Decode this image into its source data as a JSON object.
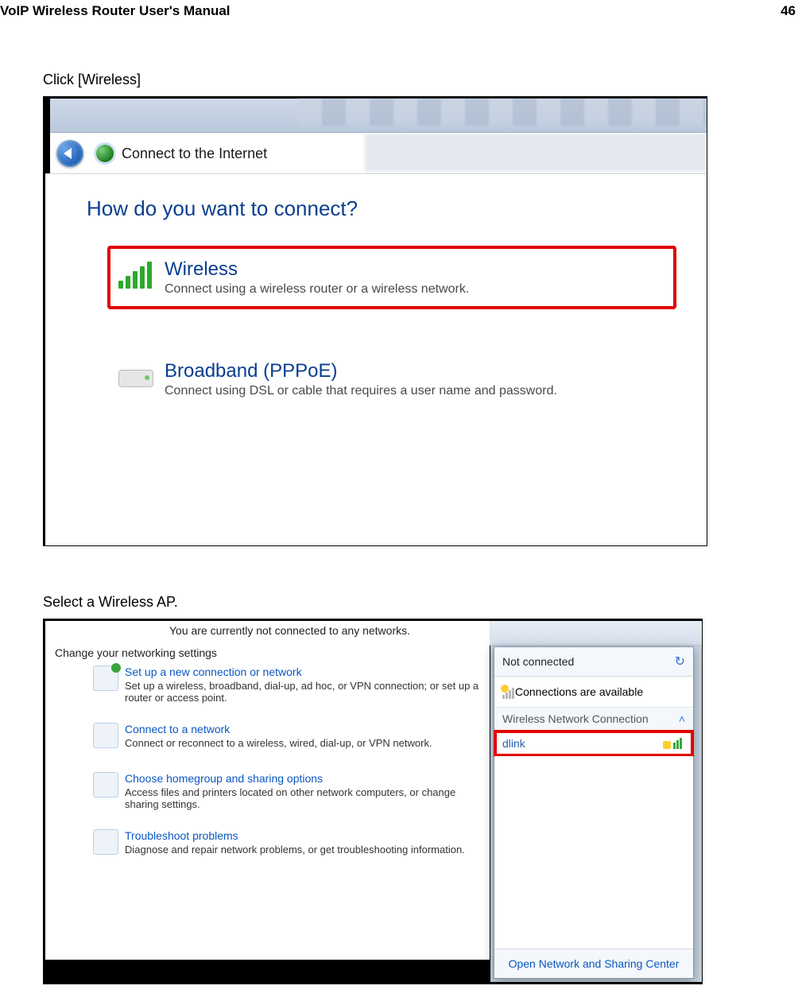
{
  "header": {
    "title": "VoIP Wireless Router User's Manual",
    "page_number": "46"
  },
  "step1": {
    "instruction": "Click [Wireless]",
    "address_bar": "Connect to the Internet",
    "prompt": "How do you want to connect?",
    "option_wireless": {
      "title": "Wireless",
      "subtitle": "Connect using a wireless router or a wireless network."
    },
    "option_pppoe": {
      "title": "Broadband (PPPoE)",
      "subtitle": "Connect using DSL or cable that requires a user name and password."
    }
  },
  "step2": {
    "instruction": "Select a Wireless AP.",
    "top_message": "You are currently not connected to any networks.",
    "section_heading": "Change your networking settings",
    "items": [
      {
        "link": "Set up a new connection or network",
        "desc": "Set up a wireless, broadband, dial-up, ad hoc, or VPN connection; or set up a router or access point."
      },
      {
        "link": "Connect to a network",
        "desc": "Connect or reconnect to a wireless, wired, dial-up, or VPN network."
      },
      {
        "link": "Choose homegroup and sharing options",
        "desc": "Access files and printers located on other network computers, or change sharing settings."
      },
      {
        "link": "Troubleshoot problems",
        "desc": "Diagnose and repair network problems, or get troubleshooting information."
      }
    ],
    "popup": {
      "status": "Not connected",
      "available_label": "Connections are available",
      "section_label": "Wireless Network Connection",
      "ap_name": "dlink",
      "footer_link": "Open Network and Sharing Center"
    }
  }
}
